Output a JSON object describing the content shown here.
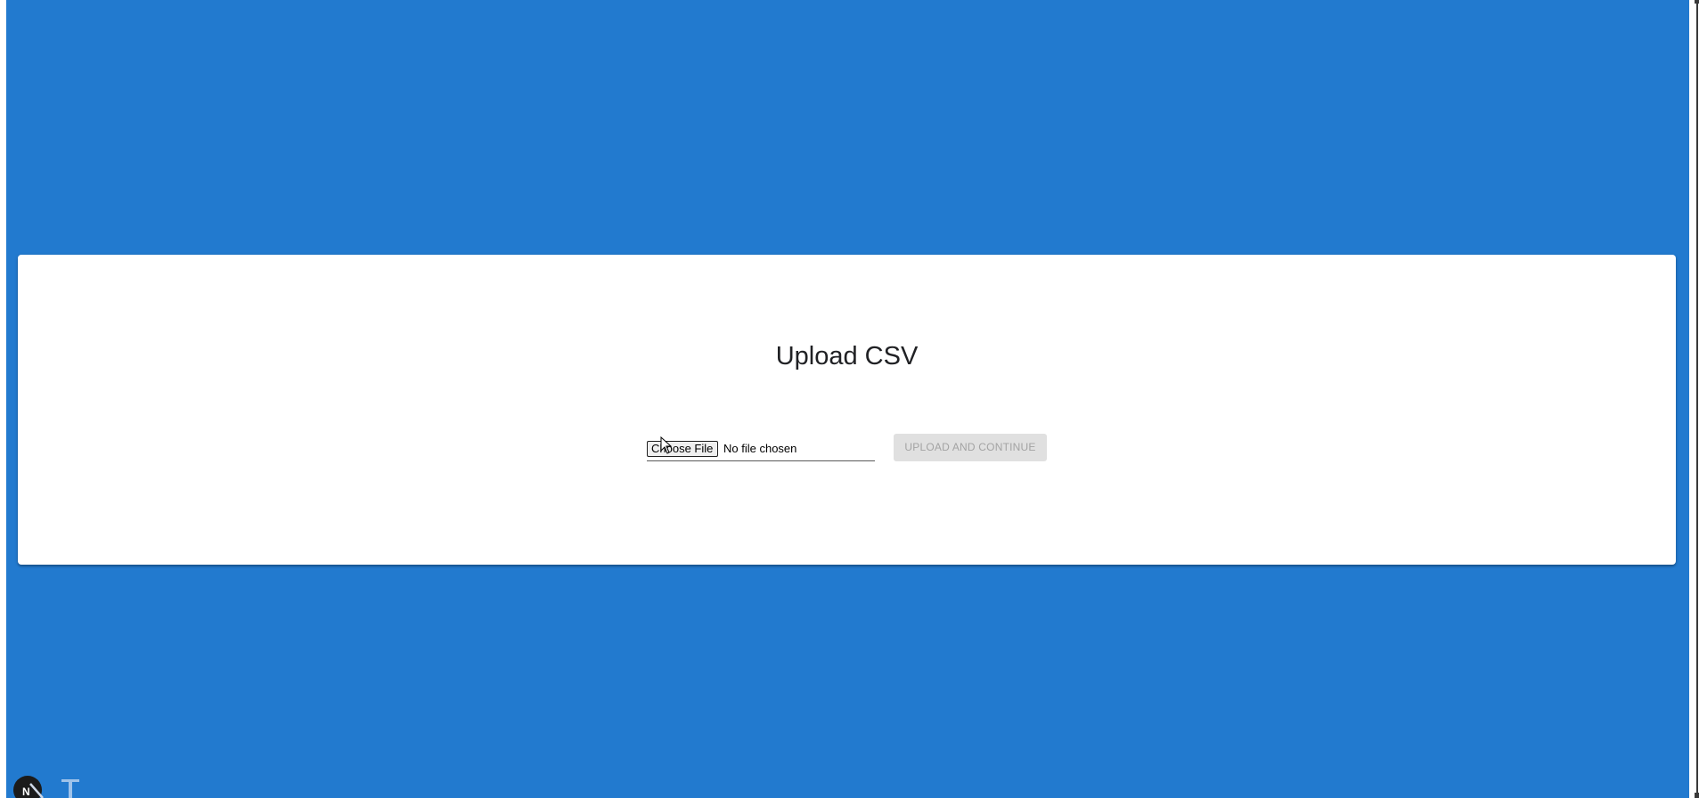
{
  "upload": {
    "title": "Upload CSV",
    "choose_file_label": "Choose File",
    "file_status": "No file chosen",
    "submit_label": "UPLOAD AND CONTINUE"
  },
  "colors": {
    "background": "#227acf",
    "card": "#ffffff",
    "disabled_button": "#e0e0e0",
    "disabled_text": "#a3a3a3"
  },
  "icons": {
    "cursor": "mouse-pointer-icon",
    "bottom_left_1": "next-logo-icon",
    "bottom_left_2": "tool-icon"
  }
}
